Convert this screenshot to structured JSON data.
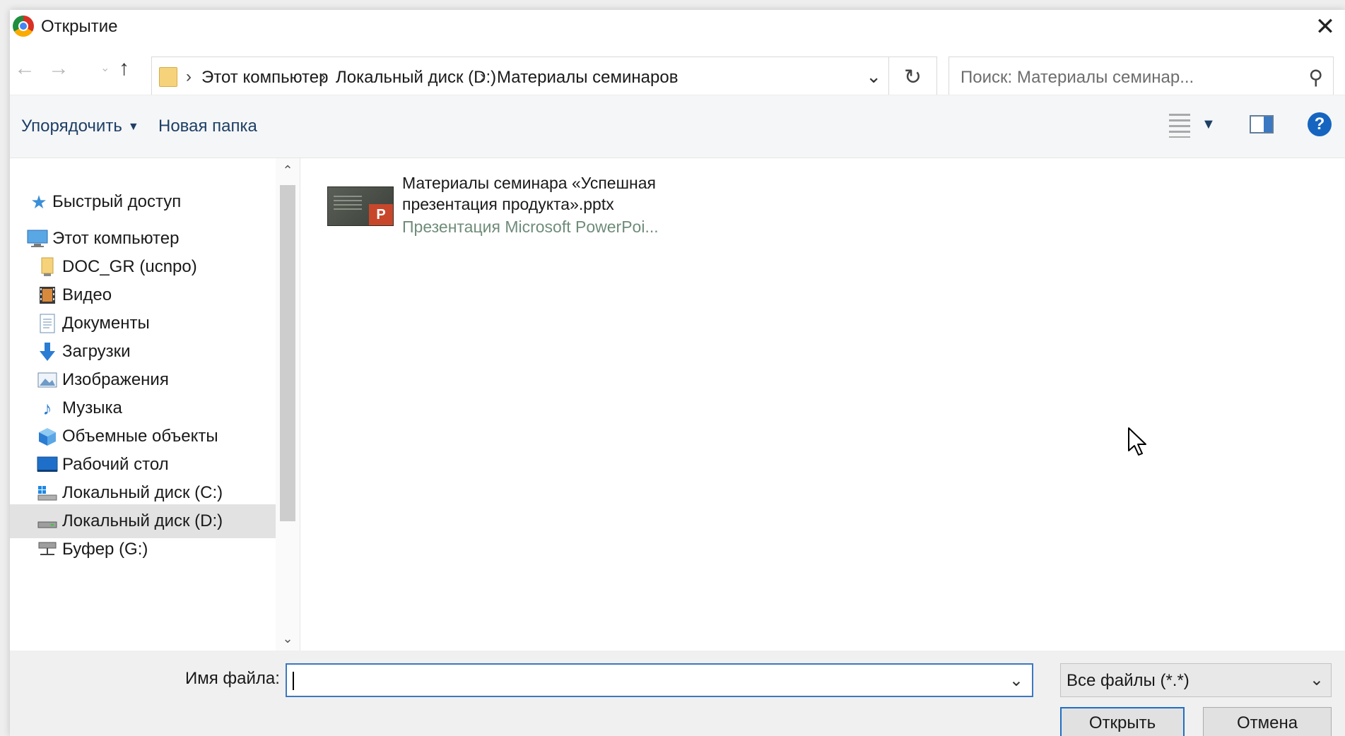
{
  "window": {
    "title": "Открытие"
  },
  "address": {
    "crumbs": [
      "Этот компьютер",
      "Локальный диск (D:)",
      "Материалы семинаров"
    ],
    "search_placeholder": "Поиск: Материалы семинар..."
  },
  "toolbar": {
    "organize_label": "Упорядочить",
    "new_folder_label": "Новая папка"
  },
  "sidebar": {
    "items": [
      {
        "label": "Быстрый доступ",
        "icon": "star-icon"
      },
      {
        "label": "Этот компьютер",
        "icon": "computer-icon"
      },
      {
        "label": "DOC_GR (ucnpo)",
        "icon": "user-folder-icon"
      },
      {
        "label": "Видео",
        "icon": "video-icon"
      },
      {
        "label": "Документы",
        "icon": "documents-icon"
      },
      {
        "label": "Загрузки",
        "icon": "download-icon"
      },
      {
        "label": "Изображения",
        "icon": "images-icon"
      },
      {
        "label": "Музыка",
        "icon": "music-icon"
      },
      {
        "label": "Объемные объекты",
        "icon": "3d-objects-icon"
      },
      {
        "label": "Рабочий стол",
        "icon": "desktop-icon"
      },
      {
        "label": "Локальный диск (C:)",
        "icon": "drive-c-icon"
      },
      {
        "label": "Локальный диск (D:)",
        "icon": "drive-d-icon",
        "selected": true
      },
      {
        "label": "Буфер (G:)",
        "icon": "network-drive-icon"
      }
    ]
  },
  "files": [
    {
      "name": "Материалы семинара «Успешная презентация продукта».pptx",
      "type": "Презентация Microsoft PowerPoi..."
    }
  ],
  "bottom": {
    "filename_label": "Имя файла:",
    "filename_value": "",
    "filetype_value": "Все файлы (*.*)",
    "open_label": "Открыть",
    "cancel_label": "Отмена"
  },
  "colors": {
    "accent": "#1f6fc5",
    "selection": "#e2e2e2",
    "link_text": "#1e3f66"
  }
}
